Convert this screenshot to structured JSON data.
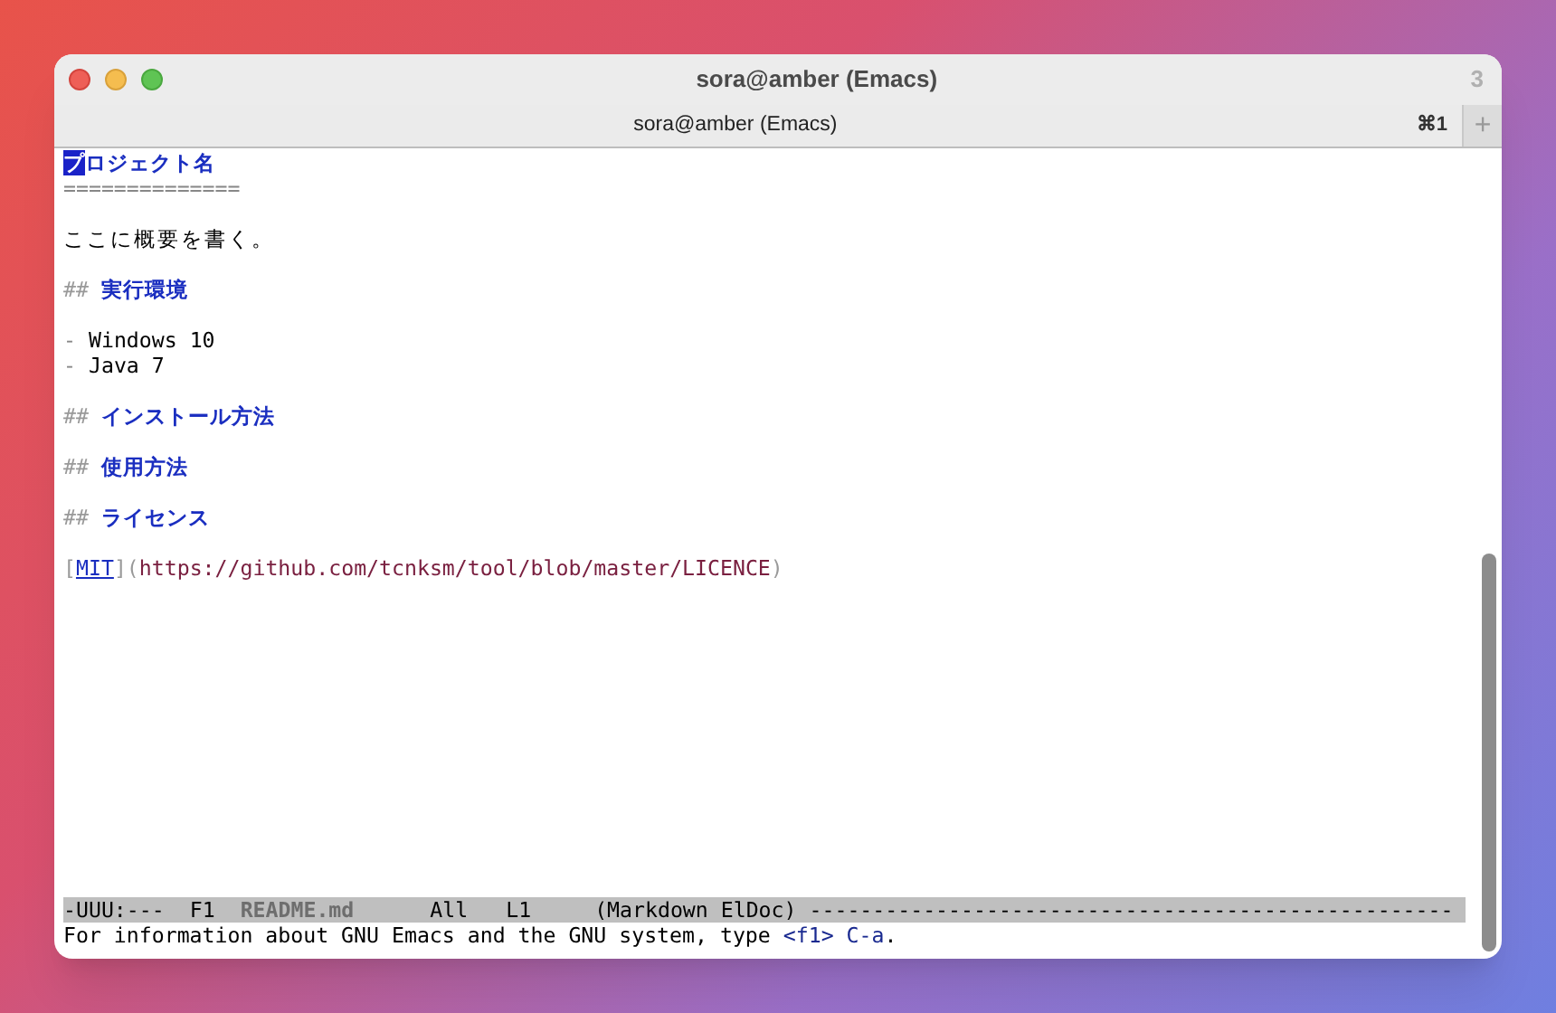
{
  "window": {
    "title": "sora@amber (Emacs)",
    "badge": "3"
  },
  "tab": {
    "label": "sora@amber (Emacs)",
    "shortcut": "⌘1",
    "new_tab": "+"
  },
  "buffer": [
    {
      "kind": "h1",
      "cursor_text": "プ",
      "text": "ロジェクト名"
    },
    {
      "kind": "rule",
      "text": "=============="
    },
    {
      "kind": "blank"
    },
    {
      "kind": "text",
      "text": "ここに概要を書く。"
    },
    {
      "kind": "blank"
    },
    {
      "kind": "h2",
      "marker": "##",
      "text": "実行環境"
    },
    {
      "kind": "blank"
    },
    {
      "kind": "item",
      "marker": "-",
      "text": "Windows 10"
    },
    {
      "kind": "item",
      "marker": "-",
      "text": "Java 7"
    },
    {
      "kind": "blank"
    },
    {
      "kind": "h2",
      "marker": "##",
      "text": "インストール方法"
    },
    {
      "kind": "blank"
    },
    {
      "kind": "h2",
      "marker": "##",
      "text": "使用方法"
    },
    {
      "kind": "blank"
    },
    {
      "kind": "h2",
      "marker": "##",
      "text": "ライセンス"
    },
    {
      "kind": "blank"
    },
    {
      "kind": "link",
      "open": "[",
      "label": "MIT",
      "middle": "](",
      "url": "https://github.com/tcnksm/tool/blob/master/LICENCE",
      "close": ")"
    }
  ],
  "mode_line": {
    "status": "-UUU:---",
    "frame": "F1",
    "buffer_name": "README.md",
    "position": "All",
    "line": "L1",
    "modes": "(Markdown ElDoc)",
    "fill": "---------------------------------------------------"
  },
  "echo_area": {
    "text": "For information about GNU Emacs and the GNU system, type ",
    "key": "<f1> C-a",
    "end": "."
  }
}
